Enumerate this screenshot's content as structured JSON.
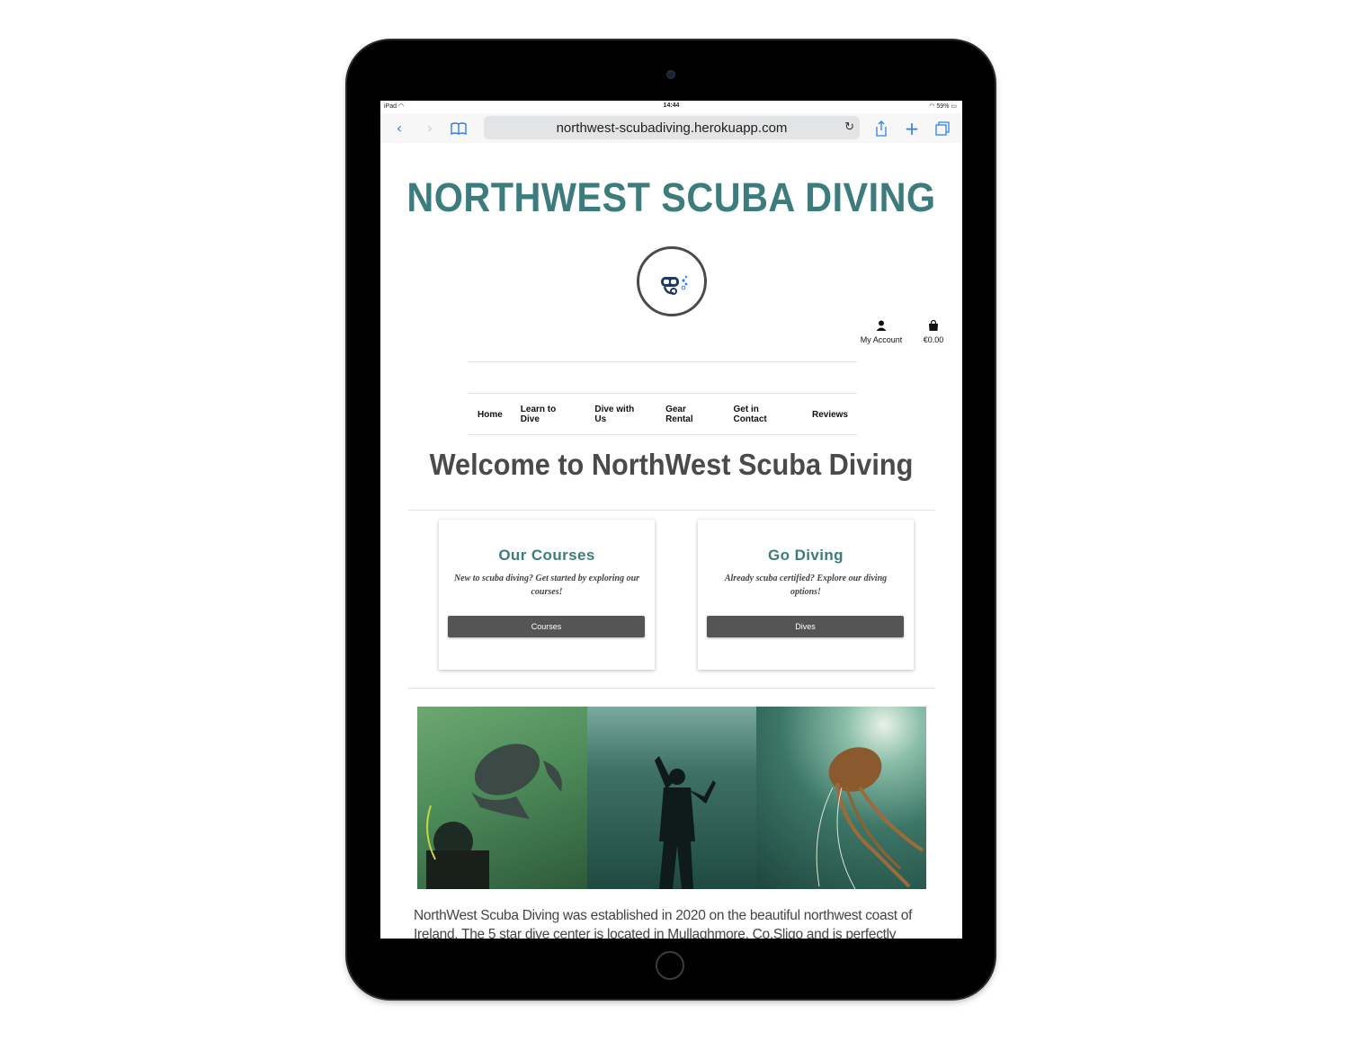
{
  "status_bar": {
    "device": "iPad",
    "time": "14:44",
    "battery": "59%"
  },
  "browser": {
    "url": "northwest-scubadiving.herokuapp.com"
  },
  "site": {
    "title": "NORTHWEST SCUBA DIVING",
    "account_label": "My Account",
    "cart_total": "€0.00"
  },
  "nav": {
    "items": [
      "Home",
      "Learn to Dive",
      "Dive with Us",
      "Gear Rental",
      "Get in Contact",
      "Reviews"
    ]
  },
  "main": {
    "heading": "Welcome to NorthWest Scuba Diving",
    "cards": [
      {
        "title": "Our Courses",
        "text": "New to scuba diving? Get started by exploring our courses!",
        "button": "Courses"
      },
      {
        "title": "Go Diving",
        "text": "Already scuba certified? Explore our diving options!",
        "button": "Dives"
      }
    ],
    "about_text": "NorthWest Scuba Diving was established in 2020 on the beautiful northwest coast of Ireland. The 5 star dive center is located in Mullaghmore, Co.Sligo and is perfectly"
  },
  "colors": {
    "brand_teal": "#3d7c7c",
    "button_gray": "#555555",
    "heading_gray": "#4a4a4a",
    "link_blue": "#2f7df6"
  }
}
